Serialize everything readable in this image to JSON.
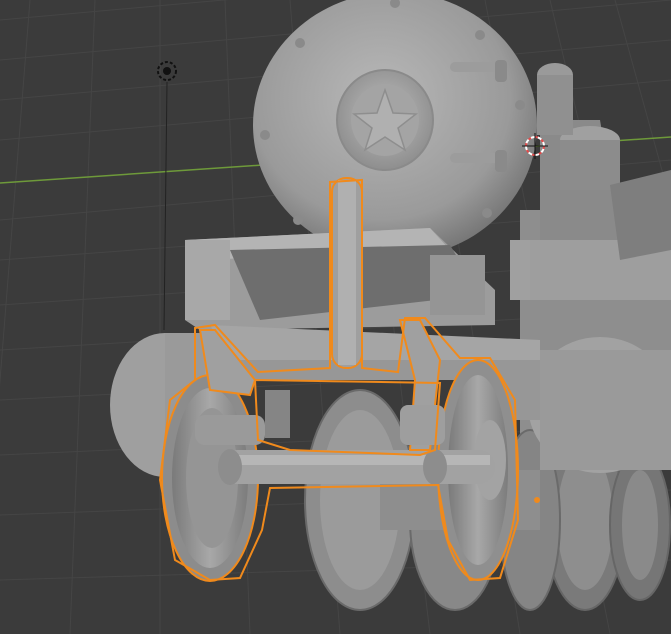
{
  "viewport": {
    "name": "3D Viewport",
    "background": "#3a3a3a",
    "grid_color": "#444444",
    "x_axis_color": "#6e9a3a",
    "selection_outline_color": "#f08a1c",
    "model_base_color": "#9c9c9c"
  },
  "scene_objects": [
    {
      "label": "boiler-front",
      "selected": false
    },
    {
      "label": "pilot-truck",
      "selected": true
    },
    {
      "label": "driver-wheels",
      "selected": false
    },
    {
      "label": "steam-dome",
      "selected": false
    }
  ],
  "gizmos": {
    "light_icon": "sun-light-icon",
    "cursor_icon": "3d-cursor-icon"
  }
}
